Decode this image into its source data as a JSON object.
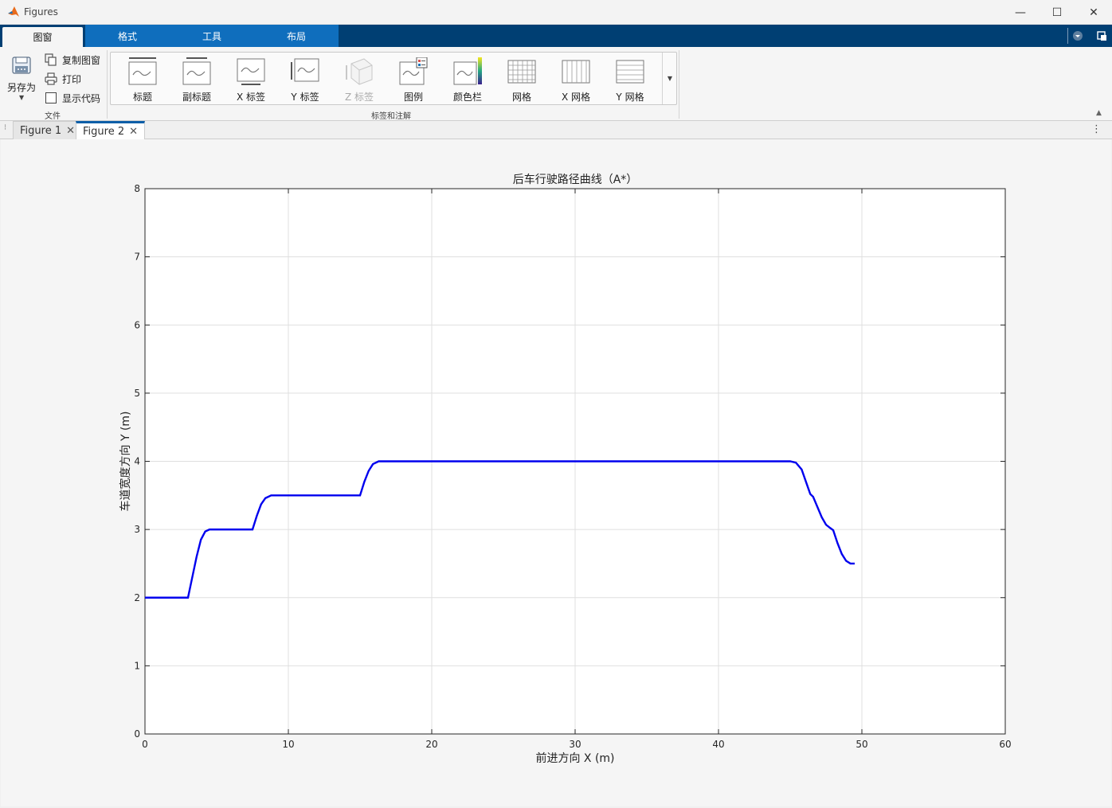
{
  "window": {
    "title": "Figures",
    "minimize_glyph": "—",
    "maximize_glyph": "☐",
    "close_glyph": "✕"
  },
  "ribbon_tabs": [
    {
      "label": "图窗",
      "active": true
    },
    {
      "label": "格式",
      "active": false
    },
    {
      "label": "工具",
      "active": false
    },
    {
      "label": "布局",
      "active": false
    }
  ],
  "file_group": {
    "save_as": "另存为",
    "copy_figure": "复制图窗",
    "print": "打印",
    "show_code": "显示代码",
    "label": "文件"
  },
  "labels_group": {
    "label": "标签和注解",
    "items": [
      {
        "label": "标题",
        "icon": "title-icon",
        "enabled": true
      },
      {
        "label": "副标题",
        "icon": "subtitle-icon",
        "enabled": true
      },
      {
        "label": "X 标签",
        "icon": "xlabel-icon",
        "enabled": true
      },
      {
        "label": "Y 标签",
        "icon": "ylabel-icon",
        "enabled": true
      },
      {
        "label": "Z 标签",
        "icon": "zlabel-icon",
        "enabled": false
      },
      {
        "label": "图例",
        "icon": "legend-icon",
        "enabled": true
      },
      {
        "label": "颜色栏",
        "icon": "colorbar-icon",
        "enabled": true
      },
      {
        "label": "网格",
        "icon": "grid-icon",
        "enabled": true
      },
      {
        "label": "X 网格",
        "icon": "xgrid-icon",
        "enabled": true
      },
      {
        "label": "Y 网格",
        "icon": "ygrid-icon",
        "enabled": true
      }
    ]
  },
  "doc_tabs": [
    {
      "label": "Figure 1",
      "active": false
    },
    {
      "label": "Figure 2",
      "active": true
    }
  ],
  "colors": {
    "accent": "#0f6ebd",
    "tabbar": "#003f73",
    "line": "#0000ee"
  },
  "chart_data": {
    "type": "line",
    "title": "后车行驶路径曲线（A*）",
    "xlabel": "前进方向 X (m)",
    "ylabel": "车道宽度方向 Y (m)",
    "xlim": [
      0,
      60
    ],
    "ylim": [
      0,
      8
    ],
    "xticks": [
      0,
      10,
      20,
      30,
      40,
      50,
      60
    ],
    "yticks": [
      0,
      1,
      2,
      3,
      4,
      5,
      6,
      7,
      8
    ],
    "grid": true,
    "series": [
      {
        "x": [
          0,
          3.0,
          3.3,
          3.6,
          3.9,
          4.2,
          4.5,
          5.0,
          7.5,
          7.8,
          8.1,
          8.4,
          8.8,
          9.3,
          15.0,
          15.3,
          15.6,
          15.9,
          16.3,
          16.8,
          45.0,
          45.4,
          45.8,
          46.1,
          46.4,
          46.6,
          46.9,
          47.2,
          47.5,
          47.8,
          48.0,
          48.3,
          48.6,
          48.9,
          49.2,
          49.5
        ],
        "y": [
          2,
          2,
          2.3,
          2.6,
          2.85,
          2.97,
          3.0,
          3.0,
          3.0,
          3.2,
          3.37,
          3.46,
          3.5,
          3.5,
          3.5,
          3.7,
          3.86,
          3.96,
          4.0,
          4.0,
          4.0,
          3.98,
          3.88,
          3.7,
          3.52,
          3.48,
          3.33,
          3.18,
          3.07,
          3.02,
          2.99,
          2.8,
          2.64,
          2.54,
          2.5,
          2.5
        ]
      }
    ]
  }
}
